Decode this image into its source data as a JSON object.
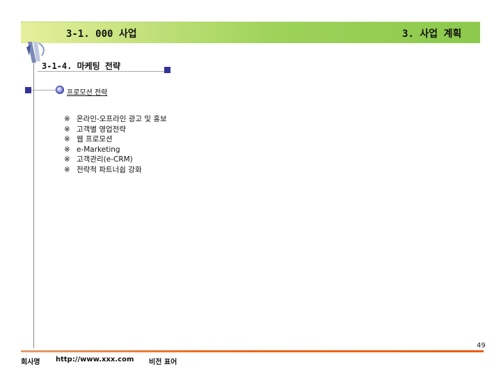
{
  "header": {
    "left_title": "3-1. 000 사업",
    "right_title": "3. 사업 계획",
    "bar_color_start": "#e6ef9c",
    "bar_color_end": "#8cc94c"
  },
  "section": {
    "title": "3-1-4. 마케팅 전략",
    "subheading": "프로모션 전략",
    "accent_color": "#333399"
  },
  "items": [
    {
      "mark": "※",
      "text": "온라인-오프라인 광고 및 홍보"
    },
    {
      "mark": "※",
      "text": "고객별 영업전략"
    },
    {
      "mark": "※",
      "text": "웹 프로모션"
    },
    {
      "mark": "※",
      "text": "e-Marketing"
    },
    {
      "mark": "※",
      "text": "고객관리(e-CRM)"
    },
    {
      "mark": "※",
      "text": "전략적 파트너쉽 강화"
    }
  ],
  "footer": {
    "company": "회사명",
    "url": "http://www.xxx.com",
    "document": "비전 표어",
    "page_number": "49",
    "line_color": "#ee6a1c"
  }
}
